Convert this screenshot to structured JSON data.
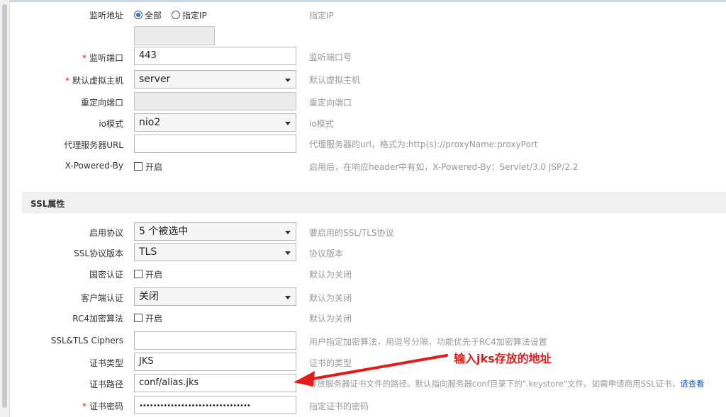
{
  "basic": {
    "listen_address": {
      "label": "监听地址",
      "option_all": "全部",
      "option_ip": "指定IP",
      "hint": "指定IP"
    },
    "listen_port": {
      "required": "*",
      "label": "监听端口",
      "value": "443",
      "hint": "监听端口号"
    },
    "default_host": {
      "required": "*",
      "label": "默认虚拟主机",
      "value": "server",
      "hint": "默认虚拟主机"
    },
    "redirect_port": {
      "label": "重定向端口",
      "value": "",
      "hint": "重定向端口"
    },
    "io_mode": {
      "label": "io模式",
      "value": "nio2",
      "hint": "io模式"
    },
    "proxy_url": {
      "label": "代理服务器URL",
      "value": "",
      "hint": "代理服务器的url，格式为:http(s)://proxyName:proxyPort"
    },
    "x_powered_by": {
      "label": "X-Powered-By",
      "checkbox_label": "开启",
      "hint": "启用后，在响应header中有如，X-Powered-By：Servlet/3.0 JSP/2.2"
    }
  },
  "ssl_section": {
    "title": "SSL属性"
  },
  "ssl": {
    "protocols": {
      "label": "启用协议",
      "value": "5 个被选中",
      "hint": "要启用的SSL/TLS协议"
    },
    "protocol_version": {
      "label": "SSL协议版本",
      "value": "TLS",
      "hint": "协议版本"
    },
    "national_crypto": {
      "label": "国密认证",
      "checkbox_label": "开启",
      "hint": "默认为关闭"
    },
    "client_auth": {
      "label": "客户端认证",
      "value": "关闭",
      "hint": "默认为关闭"
    },
    "rc4": {
      "label": "RC4加密算法",
      "checkbox_label": "开启",
      "hint": "默认为关闭"
    },
    "ciphers": {
      "label": "SSL&TLS Ciphers",
      "value": "",
      "hint": "用户指定加密算法，用逗号分隔，功能优先于RC4加密算法设置"
    },
    "cert_type": {
      "label": "证书类型",
      "value": "JKS",
      "hint": "证书的类型"
    },
    "cert_path": {
      "label": "证书路径",
      "value": "conf/alias.jks",
      "hint": "存放服务器证书文件的路径。默认指向服务器conf目录下的\".keystore\"文件。如需申请商用SSL证书，",
      "link": "请查看"
    },
    "cert_password": {
      "required": "*",
      "label": "证书密码",
      "value": "••••••••••••••••••••••••••••••••",
      "hint": "指定证书的密码"
    }
  },
  "annotation": {
    "text": "输入jks存放的地址",
    "color": "#e21b1b"
  },
  "colors": {
    "required": "#e02020",
    "hint": "#999999",
    "link": "#1a5fb4",
    "section_bg": "#f0f0f0"
  }
}
